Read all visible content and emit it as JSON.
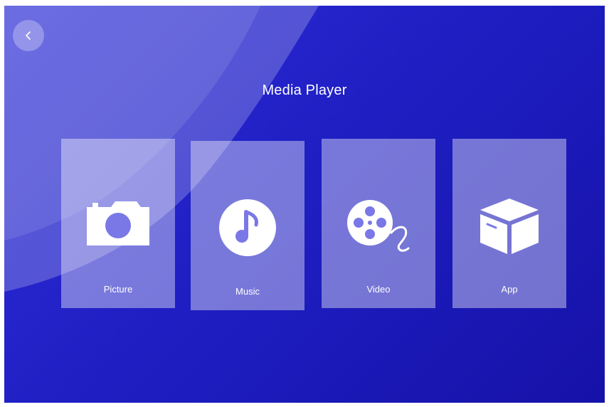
{
  "header": {
    "title": "Media Player"
  },
  "nav": {
    "back_icon": "chevron-left-icon"
  },
  "tiles": [
    {
      "label": "Picture",
      "icon": "camera-icon"
    },
    {
      "label": "Music",
      "icon": "music-note-icon"
    },
    {
      "label": "Video",
      "icon": "film-reel-icon"
    },
    {
      "label": "App",
      "icon": "box-icon"
    }
  ],
  "colors": {
    "background": "#2020c8",
    "tile": "#ffffff66",
    "text": "#ffffff"
  }
}
